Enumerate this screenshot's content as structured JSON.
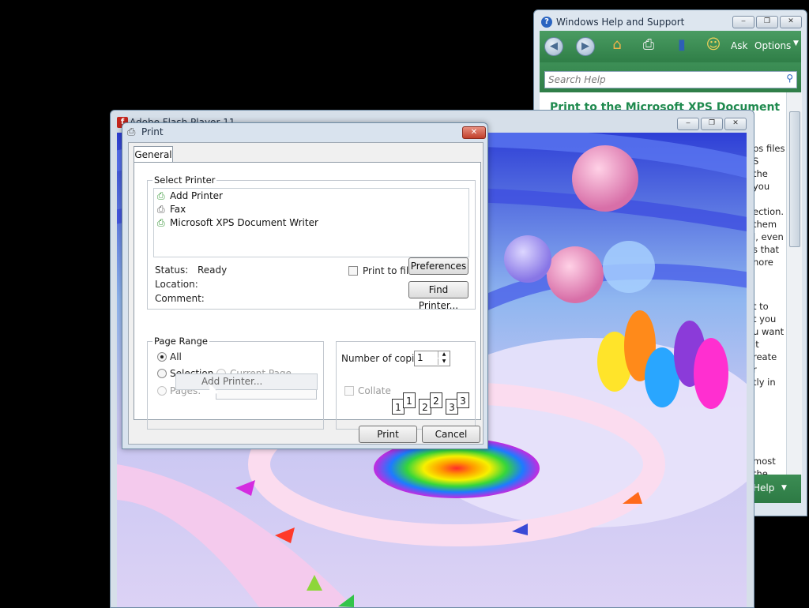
{
  "help_window": {
    "title": "Windows Help and Support",
    "toolbar": {
      "ask": "Ask",
      "options": "Options"
    },
    "search_placeholder": "Search Help",
    "heading": "Print to the Microsoft XPS Document",
    "text_fragments": [
      "ps files",
      "S",
      "the",
      "you",
      "ection.",
      "them",
      "l, even",
      "s that",
      "nore",
      "t to",
      "t you",
      "u want",
      "it",
      "reate",
      "r",
      "tly in",
      "most",
      "the"
    ],
    "bottom": {
      "help": "Help"
    }
  },
  "flash_window": {
    "title": "Adobe Flash Player 11"
  },
  "print_dialog": {
    "title": "Print",
    "tab": "General",
    "select_printer": {
      "legend": "Select Printer",
      "printers": [
        "Add Printer",
        "Fax",
        "Microsoft XPS Document Writer"
      ],
      "status_label": "Status:",
      "status_value": "Ready",
      "location_label": "Location:",
      "comment_label": "Comment:",
      "print_to_file": "Print to file",
      "preferences": "Preferences",
      "find_printer": "Find Printer..."
    },
    "page_range": {
      "legend": "Page Range",
      "all": "All",
      "selection": "Selection",
      "current_page": "Current Page",
      "pages": "Pages:"
    },
    "copies": {
      "label": "Number of copies:",
      "value": "1",
      "collate": "Collate",
      "collate_pages": [
        "1",
        "1",
        "2",
        "2",
        "3",
        "3"
      ]
    },
    "tooltip": "Add Printer...",
    "print_button": "Print",
    "cancel_button": "Cancel"
  },
  "icons": [
    "help-icon",
    "back-icon",
    "forward-icon",
    "home-icon",
    "print-icon",
    "browse-icon",
    "ask-icon",
    "search-icon",
    "flash-icon",
    "printer-icon"
  ]
}
